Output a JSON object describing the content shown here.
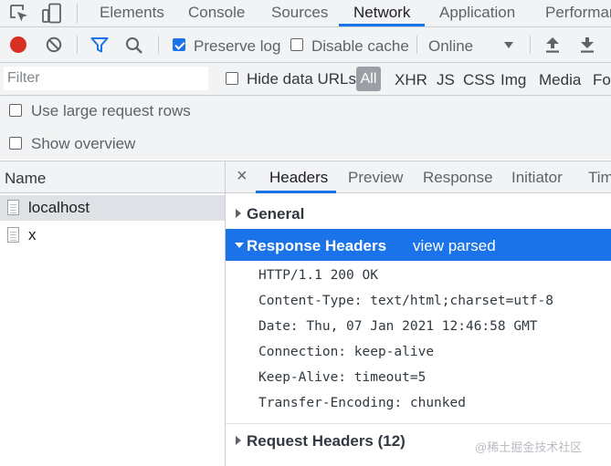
{
  "devtools": {
    "tabs": [
      "Elements",
      "Console",
      "Sources",
      "Network",
      "Application",
      "Performance"
    ],
    "active_tab": "Network",
    "accent_color": "#1a73e8",
    "record_color": "#d93025"
  },
  "toolbar": {
    "preserve_log_label": "Preserve log",
    "preserve_log_checked": true,
    "disable_cache_label": "Disable cache",
    "disable_cache_checked": false,
    "throttling_value": "Online",
    "icons": [
      "record-icon",
      "clear-icon",
      "filter-icon",
      "search-icon",
      "upload-icon",
      "download-icon"
    ]
  },
  "filter": {
    "placeholder": "Filter",
    "hide_data_urls_label": "Hide data URLs",
    "type_buttons": [
      "All",
      "XHR",
      "JS",
      "CSS",
      "Img",
      "Media",
      "Font"
    ]
  },
  "options": {
    "large_rows_label": "Use large request rows",
    "show_overview_label": "Show overview"
  },
  "request_list": {
    "header": "Name",
    "rows": [
      {
        "name": "localhost",
        "selected": true
      },
      {
        "name": "x",
        "selected": false
      }
    ]
  },
  "detail": {
    "close_glyph": "×",
    "tabs": [
      "Headers",
      "Preview",
      "Response",
      "Initiator",
      "Timing"
    ],
    "active_tab": "Headers",
    "general_label": "General",
    "response_headers_label": "Response Headers",
    "view_parsed_label": "view parsed",
    "response_headers": [
      "HTTP/1.1 200 OK",
      "Content-Type: text/html;charset=utf-8",
      "Date: Thu, 07 Jan 2021 12:46:58 GMT",
      "Connection: keep-alive",
      "Keep-Alive: timeout=5",
      "Transfer-Encoding: chunked"
    ],
    "request_headers_label": "Request Headers (12)"
  },
  "watermark": "@稀土掘金技术社区"
}
